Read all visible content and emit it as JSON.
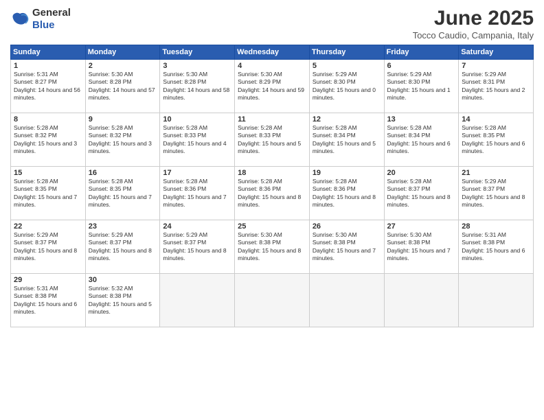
{
  "logo": {
    "general": "General",
    "blue": "Blue"
  },
  "title": "June 2025",
  "subtitle": "Tocco Caudio, Campania, Italy",
  "headers": [
    "Sunday",
    "Monday",
    "Tuesday",
    "Wednesday",
    "Thursday",
    "Friday",
    "Saturday"
  ],
  "weeks": [
    [
      {
        "day": "1",
        "sunrise": "5:31 AM",
        "sunset": "8:27 PM",
        "daylight": "14 hours and 56 minutes."
      },
      {
        "day": "2",
        "sunrise": "5:30 AM",
        "sunset": "8:28 PM",
        "daylight": "14 hours and 57 minutes."
      },
      {
        "day": "3",
        "sunrise": "5:30 AM",
        "sunset": "8:28 PM",
        "daylight": "14 hours and 58 minutes."
      },
      {
        "day": "4",
        "sunrise": "5:30 AM",
        "sunset": "8:29 PM",
        "daylight": "14 hours and 59 minutes."
      },
      {
        "day": "5",
        "sunrise": "5:29 AM",
        "sunset": "8:30 PM",
        "daylight": "15 hours and 0 minutes."
      },
      {
        "day": "6",
        "sunrise": "5:29 AM",
        "sunset": "8:30 PM",
        "daylight": "15 hours and 1 minute."
      },
      {
        "day": "7",
        "sunrise": "5:29 AM",
        "sunset": "8:31 PM",
        "daylight": "15 hours and 2 minutes."
      }
    ],
    [
      {
        "day": "8",
        "sunrise": "5:28 AM",
        "sunset": "8:32 PM",
        "daylight": "15 hours and 3 minutes."
      },
      {
        "day": "9",
        "sunrise": "5:28 AM",
        "sunset": "8:32 PM",
        "daylight": "15 hours and 3 minutes."
      },
      {
        "day": "10",
        "sunrise": "5:28 AM",
        "sunset": "8:33 PM",
        "daylight": "15 hours and 4 minutes."
      },
      {
        "day": "11",
        "sunrise": "5:28 AM",
        "sunset": "8:33 PM",
        "daylight": "15 hours and 5 minutes."
      },
      {
        "day": "12",
        "sunrise": "5:28 AM",
        "sunset": "8:34 PM",
        "daylight": "15 hours and 5 minutes."
      },
      {
        "day": "13",
        "sunrise": "5:28 AM",
        "sunset": "8:34 PM",
        "daylight": "15 hours and 6 minutes."
      },
      {
        "day": "14",
        "sunrise": "5:28 AM",
        "sunset": "8:35 PM",
        "daylight": "15 hours and 6 minutes."
      }
    ],
    [
      {
        "day": "15",
        "sunrise": "5:28 AM",
        "sunset": "8:35 PM",
        "daylight": "15 hours and 7 minutes."
      },
      {
        "day": "16",
        "sunrise": "5:28 AM",
        "sunset": "8:35 PM",
        "daylight": "15 hours and 7 minutes."
      },
      {
        "day": "17",
        "sunrise": "5:28 AM",
        "sunset": "8:36 PM",
        "daylight": "15 hours and 7 minutes."
      },
      {
        "day": "18",
        "sunrise": "5:28 AM",
        "sunset": "8:36 PM",
        "daylight": "15 hours and 8 minutes."
      },
      {
        "day": "19",
        "sunrise": "5:28 AM",
        "sunset": "8:36 PM",
        "daylight": "15 hours and 8 minutes."
      },
      {
        "day": "20",
        "sunrise": "5:28 AM",
        "sunset": "8:37 PM",
        "daylight": "15 hours and 8 minutes."
      },
      {
        "day": "21",
        "sunrise": "5:29 AM",
        "sunset": "8:37 PM",
        "daylight": "15 hours and 8 minutes."
      }
    ],
    [
      {
        "day": "22",
        "sunrise": "5:29 AM",
        "sunset": "8:37 PM",
        "daylight": "15 hours and 8 minutes."
      },
      {
        "day": "23",
        "sunrise": "5:29 AM",
        "sunset": "8:37 PM",
        "daylight": "15 hours and 8 minutes."
      },
      {
        "day": "24",
        "sunrise": "5:29 AM",
        "sunset": "8:37 PM",
        "daylight": "15 hours and 8 minutes."
      },
      {
        "day": "25",
        "sunrise": "5:30 AM",
        "sunset": "8:38 PM",
        "daylight": "15 hours and 8 minutes."
      },
      {
        "day": "26",
        "sunrise": "5:30 AM",
        "sunset": "8:38 PM",
        "daylight": "15 hours and 7 minutes."
      },
      {
        "day": "27",
        "sunrise": "5:30 AM",
        "sunset": "8:38 PM",
        "daylight": "15 hours and 7 minutes."
      },
      {
        "day": "28",
        "sunrise": "5:31 AM",
        "sunset": "8:38 PM",
        "daylight": "15 hours and 6 minutes."
      }
    ],
    [
      {
        "day": "29",
        "sunrise": "5:31 AM",
        "sunset": "8:38 PM",
        "daylight": "15 hours and 6 minutes."
      },
      {
        "day": "30",
        "sunrise": "5:32 AM",
        "sunset": "8:38 PM",
        "daylight": "15 hours and 5 minutes."
      },
      null,
      null,
      null,
      null,
      null
    ]
  ]
}
